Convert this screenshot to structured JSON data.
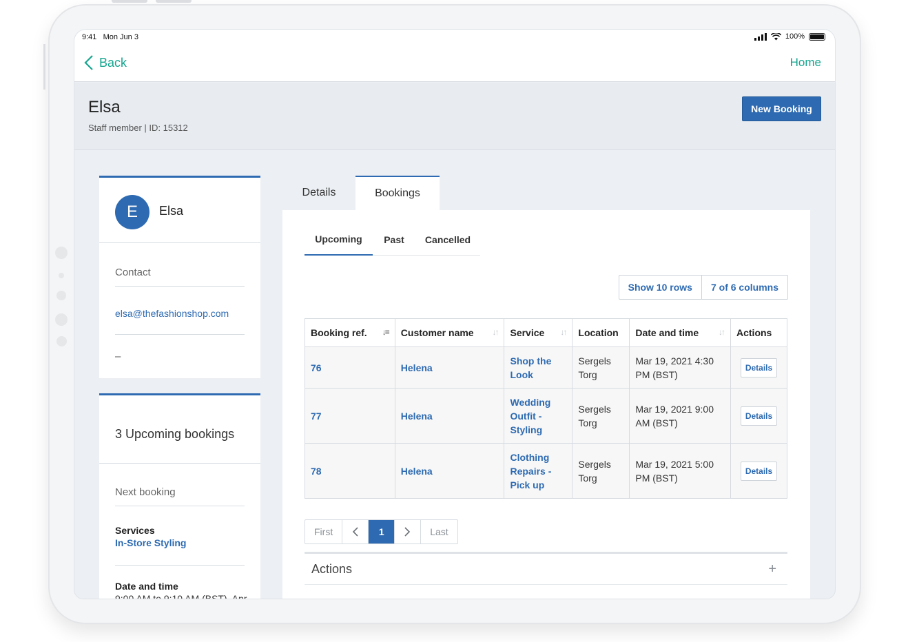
{
  "status": {
    "time": "9:41",
    "date": "Mon Jun 3",
    "battery": "100%"
  },
  "nav": {
    "back": "Back",
    "home": "Home"
  },
  "header": {
    "name": "Elsa",
    "subtitle": "Staff member | ID: 15312",
    "new_booking": "New Booking"
  },
  "profile": {
    "initial": "E",
    "name": "Elsa",
    "contact_label": "Contact",
    "email": "elsa@thefashionshop.com",
    "phone": "–"
  },
  "summary": {
    "upcoming_text": "3 Upcoming bookings",
    "next_label": "Next booking",
    "services_label": "Services",
    "services_value": "In-Store Styling",
    "datetime_label": "Date and time",
    "datetime_value": "9:00 AM to 9:10 AM (BST), Apr"
  },
  "tabs": [
    "Details",
    "Bookings"
  ],
  "subtabs": [
    "Upcoming",
    "Past",
    "Cancelled"
  ],
  "controls": {
    "rows": "Show 10 rows",
    "columns": "7 of 6 columns"
  },
  "table": {
    "headers": [
      "Booking ref.",
      "Customer name",
      "Service",
      "Location",
      "Date and time",
      "Actions"
    ],
    "rows": [
      {
        "ref": "76",
        "customer": "Helena",
        "service": "Shop the Look",
        "location": "Sergels Torg",
        "datetime": "Mar 19, 2021 4:30 PM (BST)",
        "action": "Details"
      },
      {
        "ref": "77",
        "customer": "Helena",
        "service": "Wedding Outfit - Styling",
        "location": "Sergels Torg",
        "datetime": "Mar 19, 2021 9:00 AM (BST)",
        "action": "Details"
      },
      {
        "ref": "78",
        "customer": "Helena",
        "service": "Clothing Repairs - Pick up",
        "location": "Sergels Torg",
        "datetime": "Mar 19, 2021 5:00 PM (BST)",
        "action": "Details"
      }
    ]
  },
  "pager": {
    "first": "First",
    "current": "1",
    "last": "Last"
  },
  "actions": {
    "title": "Actions",
    "plus": "+"
  }
}
